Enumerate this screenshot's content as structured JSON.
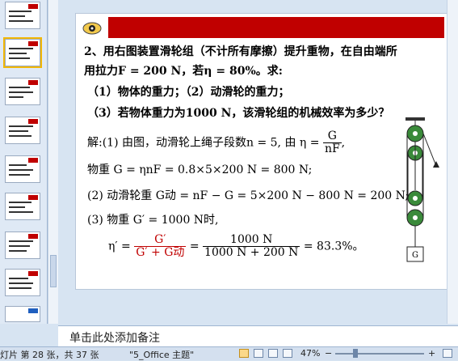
{
  "slide": {
    "question_line1": "2、用右图装置滑轮组（不计所有摩擦）提升重物，在自由端所",
    "question_line2": "用拉力F = 200 N，若η = 80%。求:",
    "question_line3": "（1）物体的重力；（2）动滑轮的重力；",
    "question_line4": "（3）若物体重力为1000 N，该滑轮组的机械效率为多少？",
    "sol1_prefix": "解:(1) 由图，动滑轮上绳子段数n = 5, 由 η =",
    "sol1_num": "G",
    "sol1_den": "nF",
    "sol1_suffix": ",",
    "sol2": "物重 G = ηnF = 0.8×5×200 N = 800 N;",
    "sol3": "(2) 动滑轮重 G动 = nF − G = 5×200 N − 800 N = 200 N;",
    "sol4": "(3) 物重 G′ = 1000 N时,",
    "eta_prime": "η′ =",
    "f1_num": "G′",
    "f1_den": "G′ + G动",
    "eq": "=",
    "f2_num": "1000 N",
    "f2_den": "1000 N + 200 N",
    "result": "= 83.3%。",
    "diagram_label": "G"
  },
  "notes": {
    "placeholder": "单击此处添加备注"
  },
  "status": {
    "slide_info": "灯片 第 28 张，共 37 张",
    "theme": "\"5_Office 主题\"",
    "zoom": "47%",
    "minus": "−",
    "plus": "+"
  },
  "colors": {
    "accent": "#c00000",
    "panel": "#d7e4f2"
  }
}
